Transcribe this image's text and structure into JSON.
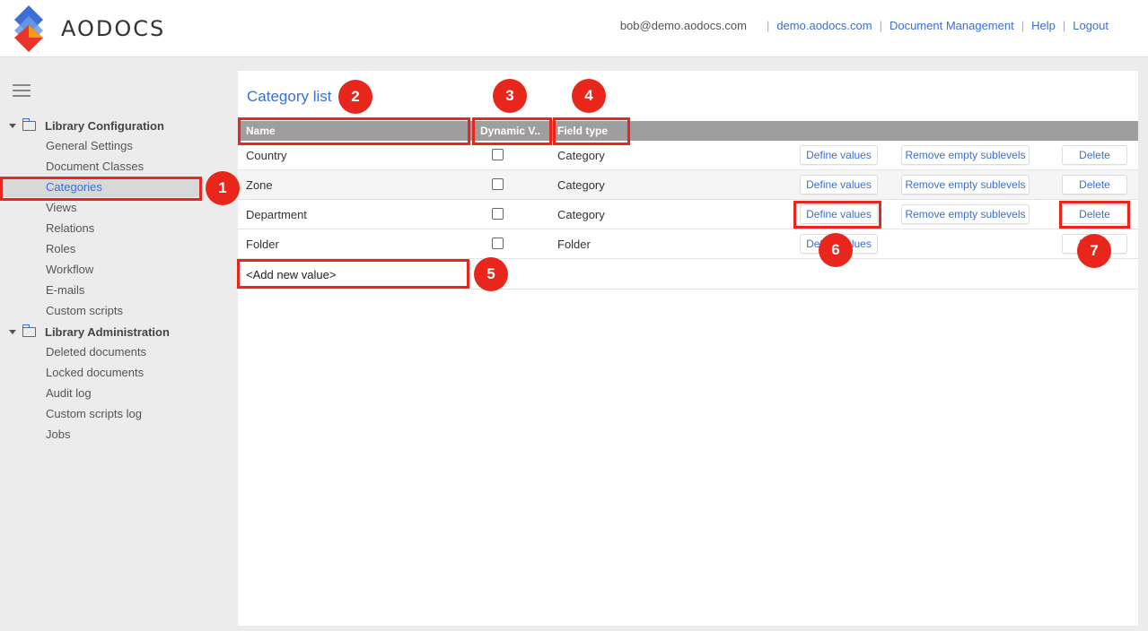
{
  "header": {
    "logo_text": "AODOCS",
    "user_email": "bob@demo.aodocs.com",
    "links": [
      "demo.aodocs.com",
      "Document Management",
      "Help",
      "Logout"
    ]
  },
  "sidebar": {
    "groups": [
      {
        "label": "Library Configuration",
        "items": [
          "General Settings",
          "Document Classes",
          "Categories",
          "Views",
          "Relations",
          "Roles",
          "Workflow",
          "E-mails",
          "Custom scripts"
        ]
      },
      {
        "label": "Library Administration",
        "items": [
          "Deleted documents",
          "Locked documents",
          "Audit log",
          "Custom scripts log",
          "Jobs"
        ]
      }
    ],
    "active_item": "Categories"
  },
  "main": {
    "title": "Category list",
    "columns": [
      "Name",
      "Dynamic V..",
      "Field type"
    ],
    "rows": [
      {
        "name": "Country",
        "dynamic": false,
        "field_type": "Category",
        "define": "Define values",
        "remove": "Remove empty sublevels",
        "delete": "Delete"
      },
      {
        "name": "Zone",
        "dynamic": false,
        "field_type": "Category",
        "define": "Define values",
        "remove": "Remove empty sublevels",
        "delete": "Delete"
      },
      {
        "name": "Department",
        "dynamic": false,
        "field_type": "Category",
        "define": "Define values",
        "remove": "Remove empty sublevels",
        "delete": "Delete"
      },
      {
        "name": "Folder",
        "dynamic": false,
        "field_type": "Folder",
        "define": "Define values",
        "delete": "Delete"
      }
    ],
    "add_new_placeholder": "<Add new value>"
  },
  "annotations": [
    "1",
    "2",
    "3",
    "4",
    "5",
    "6",
    "7"
  ],
  "colors": {
    "accent": "#3b6fd3",
    "annotation": "#e8261c",
    "header_bg": "#9e9e9e"
  }
}
